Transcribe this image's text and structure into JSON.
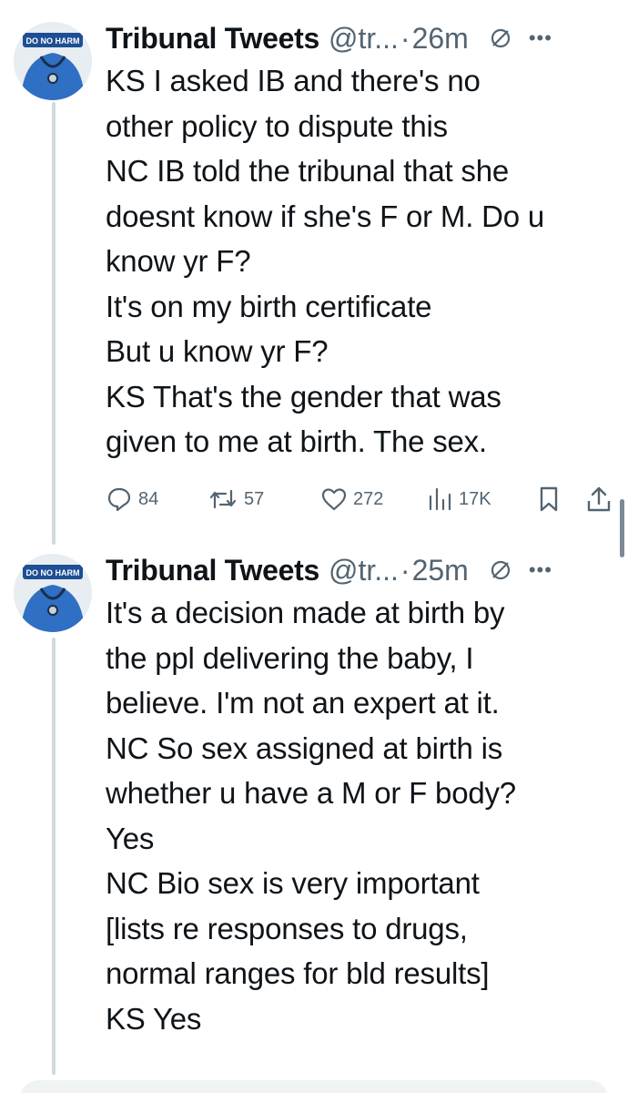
{
  "tweets": [
    {
      "name": "Tribunal Tweets",
      "handle": "@tr...",
      "separator": "·",
      "time": "26m",
      "avatar_badge": "DO NO HARM",
      "lines": [
        "KS  I asked IB and there's no",
        "other policy to dispute this",
        "NC  IB told the tribunal that she",
        "doesnt know if she's F or M. Do u",
        "know yr F?",
        "It's on my birth certificate",
        "But u know yr F?",
        "KS That's the gender that was",
        "given to me at birth. The sex."
      ],
      "metrics": {
        "replies": "84",
        "reposts": "57",
        "likes": "272",
        "views": "17K"
      }
    },
    {
      "name": "Tribunal Tweets",
      "handle": "@tr...",
      "separator": "·",
      "time": "25m",
      "avatar_badge": "DO NO HARM",
      "lines": [
        "It's a decision made at birth by",
        "the ppl delivering the baby, I",
        "believe. I'm not an expert at it.",
        "NC  So sex assigned at birth is",
        "whether u have a M or F body?",
        "Yes",
        "NC  Bio sex is very important",
        "[lists re responses to drugs,",
        "normal ranges for bld results]",
        "KS  Yes"
      ]
    }
  ],
  "icons": {
    "reply": "speech-bubble",
    "repost": "repost-arrows",
    "like": "heart",
    "views": "bar-chart",
    "bookmark": "bookmark",
    "share": "share-arrow",
    "mute": "mute-circle",
    "more": "ellipsis"
  },
  "colors": {
    "text": "#0f1419",
    "secondary": "#536471",
    "thread_line": "#cfd9de",
    "avatar_shirt": "#2f6fc4"
  }
}
